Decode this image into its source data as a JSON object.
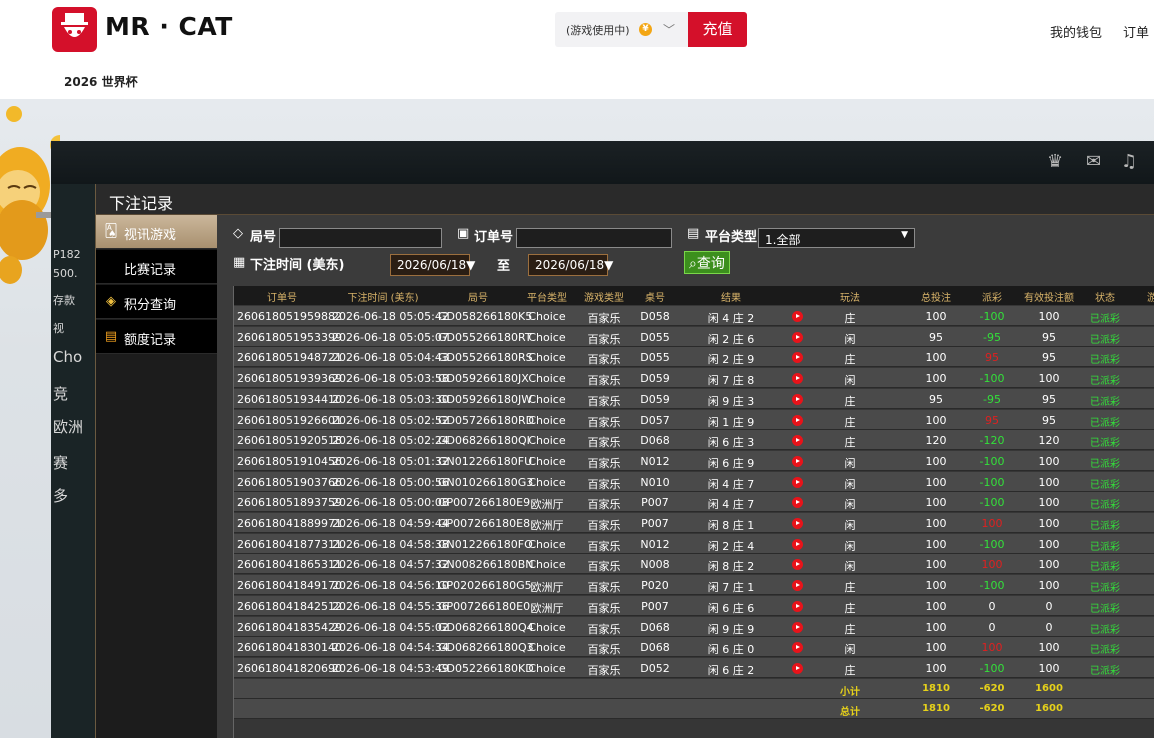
{
  "header": {
    "brand": "MR · CAT",
    "wallet_status": "(游戏使用中)",
    "recharge": "充值",
    "links": [
      "我的钱包",
      "订单"
    ],
    "subnav": "2026 世界杯"
  },
  "game": {
    "ghost_texts": [
      "P182",
      "500.",
      "存款",
      "视",
      "Cho",
      "竞",
      "欧洲",
      "赛",
      "多"
    ]
  },
  "modal": {
    "title": "下注记录",
    "sidebar": [
      {
        "label": "视讯游戏",
        "active": true
      },
      {
        "label": "比赛记录",
        "sub": true
      },
      {
        "label": "积分查询"
      },
      {
        "label": "额度记录"
      }
    ],
    "filters": {
      "round_label": "局号",
      "order_label": "订单号",
      "platform_label": "平台类型",
      "platform_value": "1.全部",
      "time_label": "下注时间 (美东)",
      "date_from": "2026/06/18",
      "date_to_sep": "至",
      "date_to": "2026/06/18",
      "query": "查询"
    },
    "table": {
      "headers": [
        "订单号",
        "下注时间 (美东)",
        "局号",
        "平台类型",
        "游戏类型",
        "桌号",
        "结果",
        "玩法",
        "总投注",
        "派彩",
        "有效投注额",
        "状态",
        "游"
      ],
      "rows": [
        [
          "260618051959882",
          "2026-06-18 05:05:42",
          "GD058266180K5",
          "Choice",
          "百家乐",
          "D058",
          "闲 4 庄 2",
          "庄",
          "100",
          "-100",
          "100",
          "已派彩"
        ],
        [
          "260618051953399",
          "2026-06-18 05:05:07",
          "GD055266180RT",
          "Choice",
          "百家乐",
          "D055",
          "闲 2 庄 6",
          "闲",
          "95",
          "-95",
          "95",
          "已派彩"
        ],
        [
          "260618051948721",
          "2026-06-18 05:04:43",
          "GD055266180RS",
          "Choice",
          "百家乐",
          "D055",
          "闲 2 庄 9",
          "庄",
          "100",
          "95",
          "95",
          "已派彩"
        ],
        [
          "260618051939369",
          "2026-06-18 05:03:58",
          "GD059266180JX",
          "Choice",
          "百家乐",
          "D059",
          "闲 7 庄 8",
          "闲",
          "100",
          "-100",
          "100",
          "已派彩"
        ],
        [
          "260618051934410",
          "2026-06-18 05:03:30",
          "GD059266180JW",
          "Choice",
          "百家乐",
          "D059",
          "闲 9 庄 3",
          "庄",
          "95",
          "-95",
          "95",
          "已派彩"
        ],
        [
          "260618051926601",
          "2026-06-18 05:02:52",
          "GD057266180RD",
          "Choice",
          "百家乐",
          "D057",
          "闲 1 庄 9",
          "庄",
          "100",
          "95",
          "95",
          "已派彩"
        ],
        [
          "260618051920518",
          "2026-06-18 05:02:24",
          "GD068266180QI",
          "Choice",
          "百家乐",
          "D068",
          "闲 6 庄 3",
          "庄",
          "120",
          "-120",
          "120",
          "已派彩"
        ],
        [
          "260618051910456",
          "2026-06-18 05:01:32",
          "GN012266180FU",
          "Choice",
          "百家乐",
          "N012",
          "闲 6 庄 9",
          "闲",
          "100",
          "-100",
          "100",
          "已派彩"
        ],
        [
          "260618051903766",
          "2026-06-18 05:00:56",
          "GN010266180G3",
          "Choice",
          "百家乐",
          "N010",
          "闲 4 庄 7",
          "闲",
          "100",
          "-100",
          "100",
          "已派彩"
        ],
        [
          "260618051893759",
          "2026-06-18 05:00:08",
          "GP007266180E9",
          "欧洲厅",
          "百家乐",
          "P007",
          "闲 4 庄 7",
          "闲",
          "100",
          "-100",
          "100",
          "已派彩"
        ],
        [
          "260618041889971",
          "2026-06-18 04:59:44",
          "GP007266180E8",
          "欧洲厅",
          "百家乐",
          "P007",
          "闲 8 庄 1",
          "闲",
          "100",
          "100",
          "100",
          "已派彩"
        ],
        [
          "260618041877311",
          "2026-06-18 04:58:38",
          "GN012266180FO",
          "Choice",
          "百家乐",
          "N012",
          "闲 2 庄 4",
          "闲",
          "100",
          "-100",
          "100",
          "已派彩"
        ],
        [
          "260618041865311",
          "2026-06-18 04:57:32",
          "GN008266180BN",
          "Choice",
          "百家乐",
          "N008",
          "闲 8 庄 2",
          "闲",
          "100",
          "100",
          "100",
          "已派彩"
        ],
        [
          "260618041849170",
          "2026-06-18 04:56:10",
          "GP020266180G5",
          "欧洲厅",
          "百家乐",
          "P020",
          "闲 7 庄 1",
          "庄",
          "100",
          "-100",
          "100",
          "已派彩"
        ],
        [
          "260618041842512",
          "2026-06-18 04:55:36",
          "GP007266180E0",
          "欧洲厅",
          "百家乐",
          "P007",
          "闲 6 庄 6",
          "庄",
          "100",
          "0",
          "0",
          "已派彩"
        ],
        [
          "260618041835429",
          "2026-06-18 04:55:02",
          "GD068266180Q4",
          "Choice",
          "百家乐",
          "D068",
          "闲 9 庄 9",
          "庄",
          "100",
          "0",
          "0",
          "已派彩"
        ],
        [
          "260618041830140",
          "2026-06-18 04:54:34",
          "GD068266180Q3",
          "Choice",
          "百家乐",
          "D068",
          "闲 6 庄 0",
          "闲",
          "100",
          "100",
          "100",
          "已派彩"
        ],
        [
          "260618041820690",
          "2026-06-18 04:53:49",
          "GD052266180KD",
          "Choice",
          "百家乐",
          "D052",
          "闲 6 庄 2",
          "庄",
          "100",
          "-100",
          "100",
          "已派彩"
        ]
      ],
      "subtotal": {
        "label": "小计",
        "bet": "1810",
        "payout": "-620",
        "valid": "1600"
      },
      "total": {
        "label": "总计",
        "bet": "1810",
        "payout": "-620",
        "valid": "1600"
      }
    }
  }
}
